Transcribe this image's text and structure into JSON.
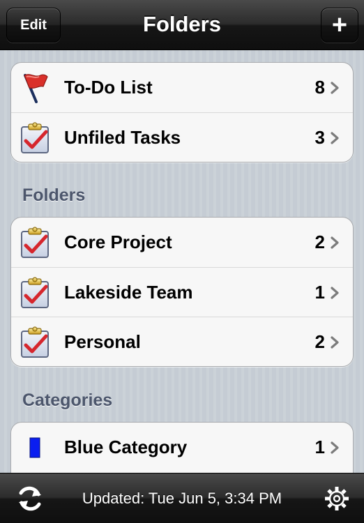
{
  "navbar": {
    "title": "Folders",
    "edit_label": "Edit",
    "add_label": "+"
  },
  "top_group": [
    {
      "label": "To-Do List",
      "count": "8",
      "icon": "flag-icon"
    },
    {
      "label": "Unfiled Tasks",
      "count": "3",
      "icon": "clipboard-check-icon"
    }
  ],
  "folders": {
    "header": "Folders",
    "items": [
      {
        "label": "Core Project",
        "count": "2",
        "icon": "clipboard-check-icon"
      },
      {
        "label": "Lakeside Team",
        "count": "1",
        "icon": "clipboard-check-icon"
      },
      {
        "label": "Personal",
        "count": "2",
        "icon": "clipboard-check-icon"
      }
    ]
  },
  "categories": {
    "header": "Categories",
    "items": [
      {
        "label": "Blue Category",
        "count": "1",
        "icon": "blue-swatch-icon",
        "color": "#0a1ef0"
      }
    ]
  },
  "toolbar": {
    "status": "Updated: Tue Jun 5, 3:34 PM",
    "sync_icon": "sync-icon",
    "settings_icon": "gear-icon"
  },
  "colors": {
    "bar": "#1a1a1a",
    "section_header": "#4c566c",
    "check": "#d6262d",
    "flag": "#d9302a",
    "category_blue": "#0a1ef0"
  }
}
